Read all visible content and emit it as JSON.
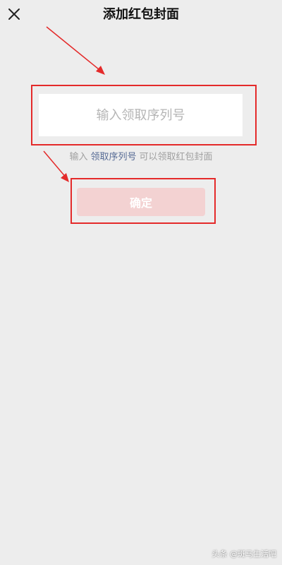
{
  "header": {
    "title": "添加红包封面",
    "close_icon": "close-icon"
  },
  "form": {
    "serial_placeholder": "输入领取序列号",
    "serial_value": ""
  },
  "hint": {
    "prefix": "输入",
    "link": "领取序列号",
    "suffix": "可以领取红包封面"
  },
  "actions": {
    "confirm_label": "确定"
  },
  "annotations": {
    "color": "#e42a2a"
  },
  "watermark": {
    "text": "头条 @斑马生活吧"
  }
}
